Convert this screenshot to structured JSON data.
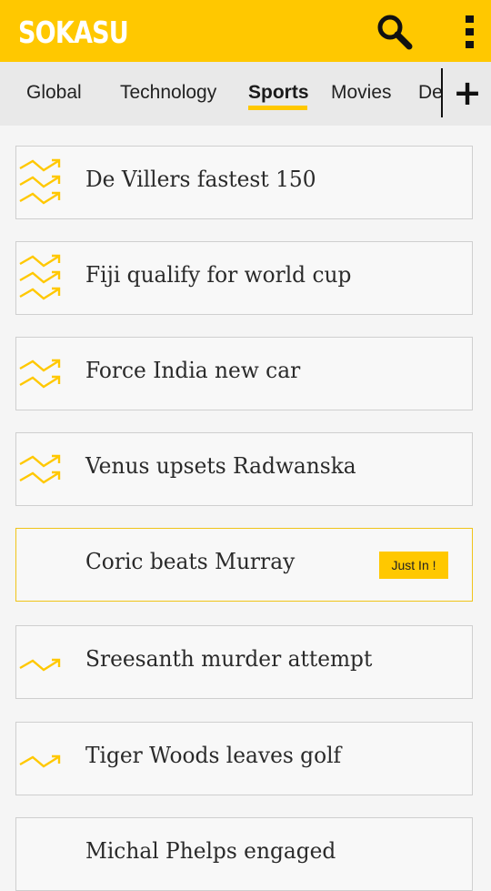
{
  "app": {
    "brand": "SOKASU",
    "accent_color": "#ffc800",
    "actions": {
      "search_icon": "search-icon",
      "menu_icon": "more-vertical-icon"
    }
  },
  "tabs": {
    "items": [
      "Global",
      "Technology",
      "Sports",
      "Movies",
      "De"
    ],
    "active": "Sports",
    "add_label": "+"
  },
  "feed": {
    "items": [
      {
        "title": "De Villers fastest 150",
        "trend_level": 3
      },
      {
        "title": "Fiji qualify for world cup",
        "trend_level": 3
      },
      {
        "title": "Force India new car",
        "trend_level": 2
      },
      {
        "title": "Venus upsets Radwanska",
        "trend_level": 2
      },
      {
        "title": "Coric beats Murray",
        "trend_level": 0,
        "badge": "Just In !"
      },
      {
        "title": "Sreesanth murder attempt",
        "trend_level": 1
      },
      {
        "title": "Tiger Woods leaves golf",
        "trend_level": 1
      },
      {
        "title": "Michal Phelps engaged",
        "trend_level": 0
      }
    ]
  }
}
